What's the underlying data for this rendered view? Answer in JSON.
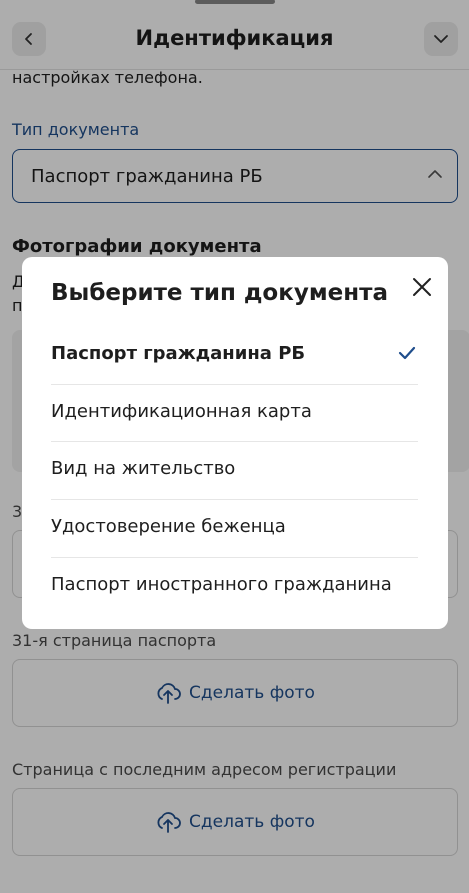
{
  "header": {
    "title": "Идентификация"
  },
  "form": {
    "hint_tail": "настройках телефона.",
    "doc_type_label": "Тип документа",
    "doc_type_value": "Паспорт гражданина РБ",
    "photos_title": "Фотографии документа",
    "photos_desc_line1": "Д",
    "photos_desc_line2": "п",
    "upload1_caption": "3",
    "upload2_caption": "31-я страница паспорта",
    "upload3_caption": "Страница с последним адресом регистрации",
    "upload_button_label": "Сделать фото"
  },
  "modal": {
    "title": "Выберите тип документа",
    "options": [
      {
        "label": "Паспорт гражданина РБ",
        "selected": true
      },
      {
        "label": "Идентификационная карта",
        "selected": false
      },
      {
        "label": "Вид на жительство",
        "selected": false
      },
      {
        "label": "Удостоверение беженца",
        "selected": false
      },
      {
        "label": "Паспорт иностранного гражданина",
        "selected": false
      }
    ]
  },
  "colors": {
    "accent": "#1f4e8c",
    "overlay": "rgba(0,0,0,0.32)"
  },
  "icons": [
    "chevron-left-icon",
    "chevron-down-icon",
    "chevron-up-icon",
    "upload-icon",
    "close-icon",
    "check-icon"
  ]
}
